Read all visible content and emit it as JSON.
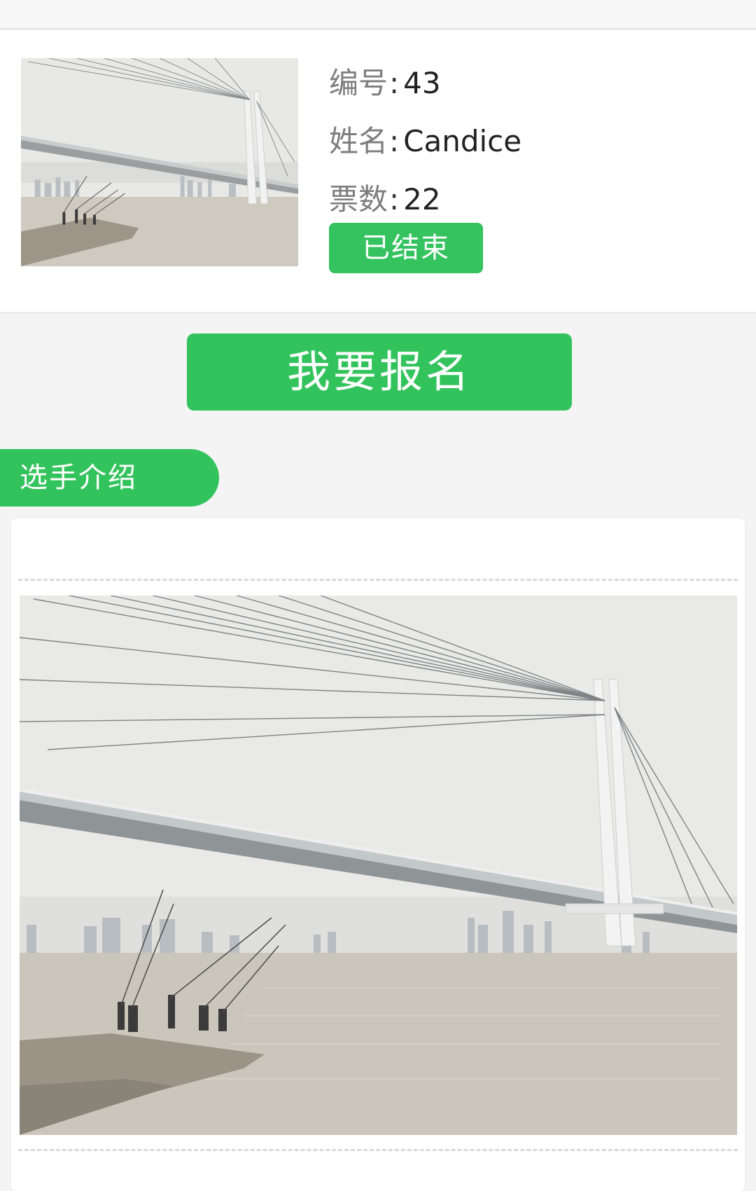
{
  "header": {},
  "contestant": {
    "number_label": "编号",
    "number_value": "43",
    "name_label": "姓名",
    "name_value": "Candice",
    "votes_label": "票数",
    "votes_value": "22",
    "colon": ":",
    "status_label": "已结束"
  },
  "actions": {
    "signup_label": "我要报名"
  },
  "intro_section": {
    "tab_label": "选手介绍",
    "text": ""
  },
  "colors": {
    "accent": "#33c35d",
    "background": "#f4f4f4"
  },
  "icons": {
    "photo_thumb": "bridge-photo",
    "photo_main": "bridge-photo"
  }
}
